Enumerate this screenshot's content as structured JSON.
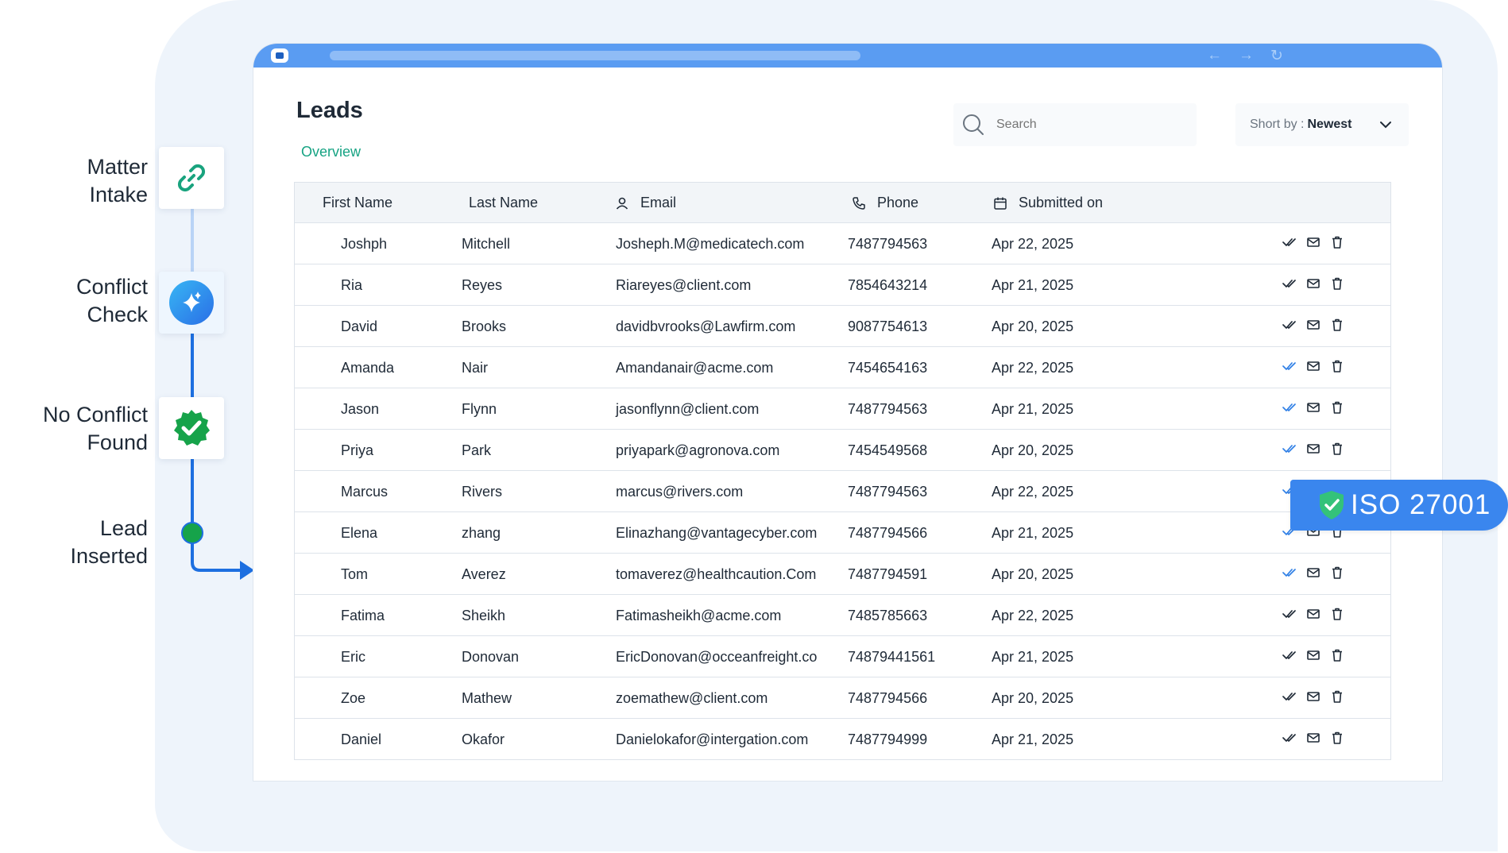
{
  "workflow": {
    "steps": [
      {
        "line1": "Matter",
        "line2": "Intake",
        "icon": "link-icon"
      },
      {
        "line1": "Conflict",
        "line2": "Check",
        "icon": "sparkle-icon"
      },
      {
        "line1": "No Conflict",
        "line2": "Found",
        "icon": "check-badge-icon"
      },
      {
        "line1": "Lead",
        "line2": "Inserted",
        "icon": "dot-icon"
      }
    ],
    "colors": {
      "line": "#1d6fe0",
      "line_light": "#b9d4f6",
      "green": "#16a34a",
      "teal": "#19a37e"
    }
  },
  "page": {
    "title": "Leads",
    "overview": "Overview",
    "search_placeholder": "Search",
    "sort_label": "Short by :",
    "sort_value": "Newest"
  },
  "table": {
    "headers": {
      "first_name": "First Name",
      "last_name": "Last Name",
      "email": "Email",
      "phone": "Phone",
      "submitted_on": "Submitted on"
    },
    "rows": [
      {
        "first": "Joshph",
        "last": "Mitchell",
        "email": "Josheph.M@medicatech.com",
        "phone": "7487794563",
        "date": "Apr 22, 2025",
        "verified": false
      },
      {
        "first": "Ria",
        "last": "Reyes",
        "email": "Riareyes@client.com",
        "phone": "7854643214",
        "date": "Apr 21, 2025",
        "verified": false
      },
      {
        "first": "David",
        "last": "Brooks",
        "email": "davidbvrooks@Lawfirm.com",
        "phone": "9087754613",
        "date": "Apr 20, 2025",
        "verified": false
      },
      {
        "first": "Amanda",
        "last": "Nair",
        "email": "Amandanair@acme.com",
        "phone": "7454654163",
        "date": "Apr 22, 2025",
        "verified": true
      },
      {
        "first": "Jason",
        "last": "Flynn",
        "email": "jasonflynn@client.com",
        "phone": "7487794563",
        "date": "Apr 21, 2025",
        "verified": true
      },
      {
        "first": "Priya",
        "last": "Park",
        "email": "priyapark@agronova.com",
        "phone": "7454549568",
        "date": "Apr 20, 2025",
        "verified": true
      },
      {
        "first": "Marcus",
        "last": "Rivers",
        "email": "marcus@rivers.com",
        "phone": "7487794563",
        "date": "Apr 22, 2025",
        "verified": true
      },
      {
        "first": "Elena",
        "last": "zhang",
        "email": "Elinazhang@vantagecyber.com",
        "phone": "7487794566",
        "date": "Apr 21, 2025",
        "verified": true
      },
      {
        "first": "Tom",
        "last": "Averez",
        "email": "tomaverez@healthcaution.Com",
        "phone": "7487794591",
        "date": "Apr 20, 2025",
        "verified": true
      },
      {
        "first": "Fatima",
        "last": "Sheikh",
        "email": "Fatimasheikh@acme.com",
        "phone": "7485785663",
        "date": "Apr 22, 2025",
        "verified": false
      },
      {
        "first": "Eric",
        "last": "Donovan",
        "email": "EricDonovan@occeanfreight.co",
        "phone": "74879441561",
        "date": "Apr 21, 2025",
        "verified": false
      },
      {
        "first": "Zoe",
        "last": "Mathew",
        "email": "zoemathew@client.com",
        "phone": "7487794566",
        "date": "Apr 20, 2025",
        "verified": false
      },
      {
        "first": "Daniel",
        "last": "Okafor",
        "email": "Danielokafor@intergation.com",
        "phone": "7487794999",
        "date": "Apr 21, 2025",
        "verified": false
      }
    ],
    "action_icons": [
      "double-check-icon",
      "mail-icon",
      "trash-icon"
    ],
    "colors": {
      "verified": "#2f7fe6",
      "unverified": "#1f2a37"
    }
  },
  "badge": {
    "text": "ISO 27001",
    "icon": "shield-check-icon",
    "color": "#3a86ee"
  }
}
